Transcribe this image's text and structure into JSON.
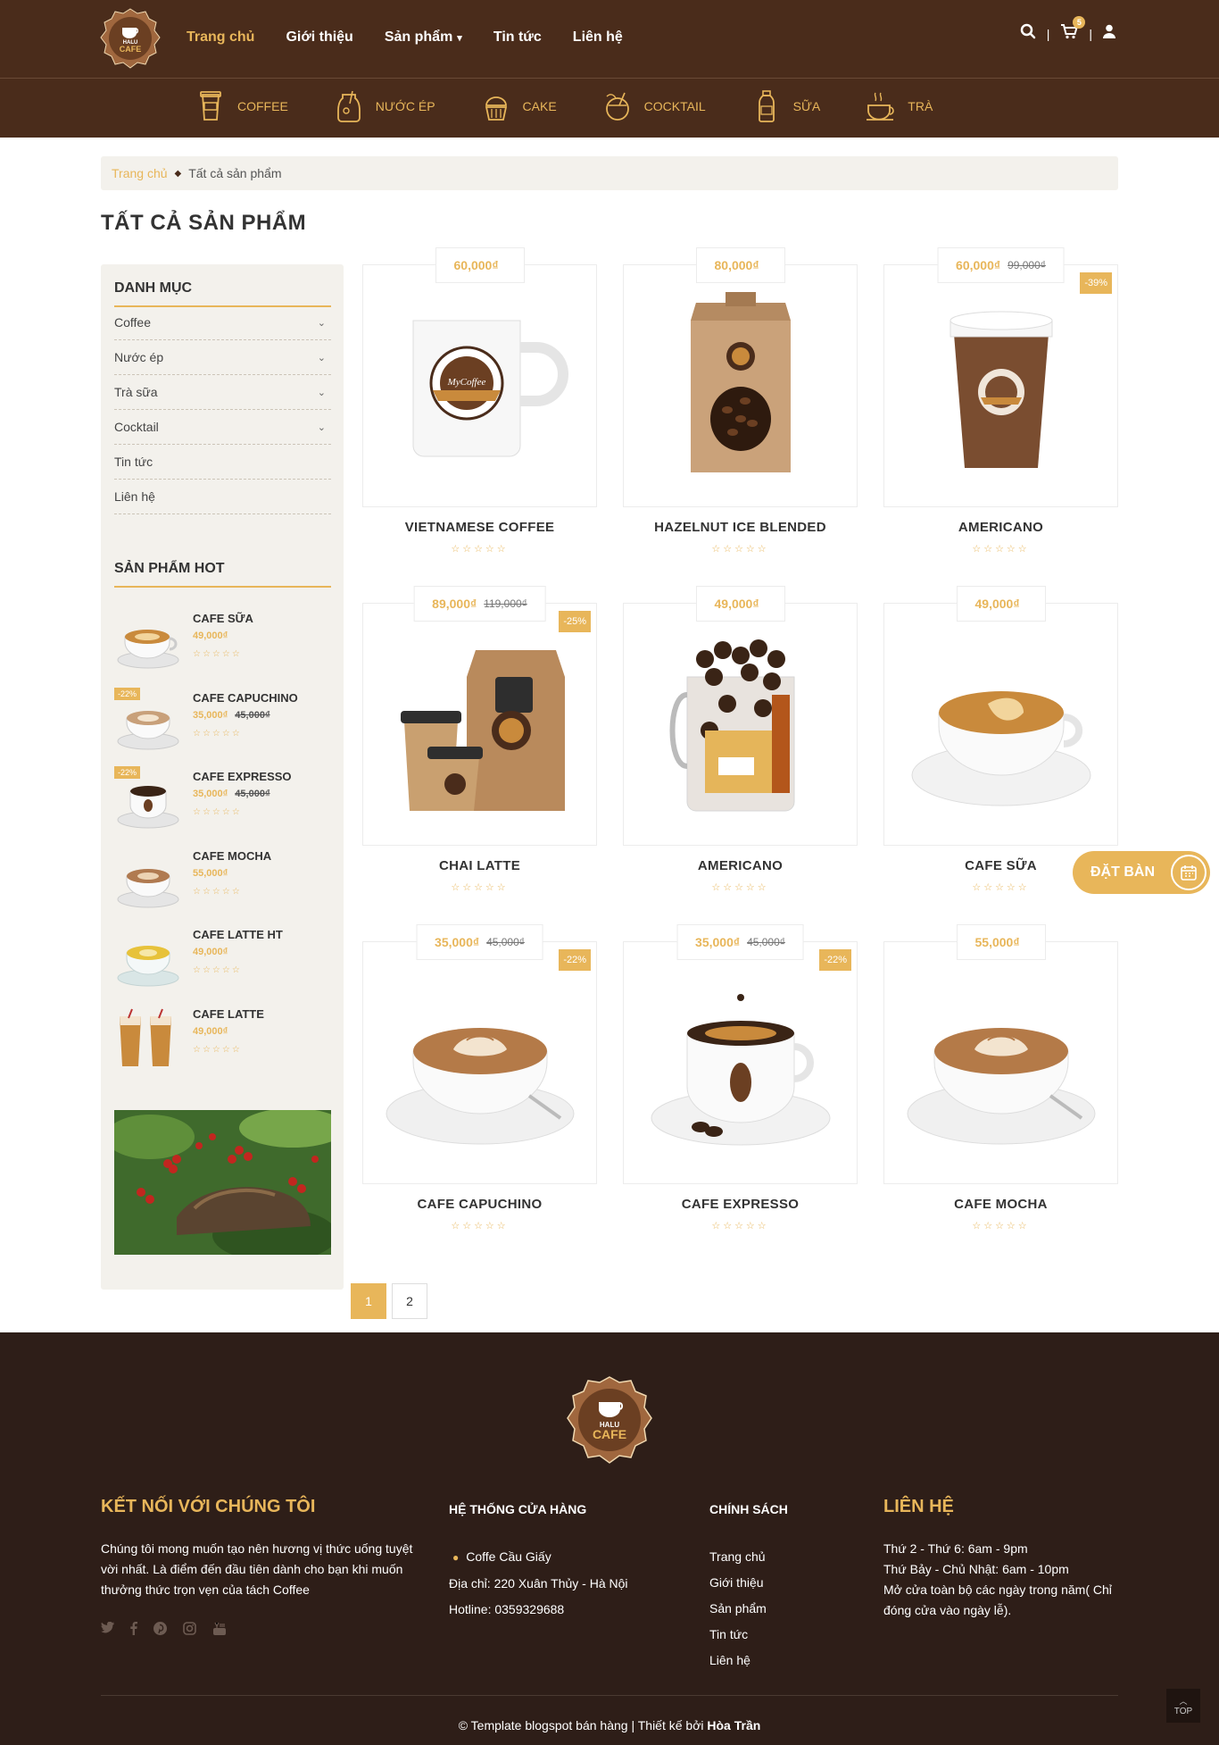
{
  "header": {
    "nav": [
      {
        "label": "Trang chủ",
        "active": true
      },
      {
        "label": "Giới thiệu"
      },
      {
        "label": "Sản phẩm",
        "has_dropdown": true
      },
      {
        "label": "Tin tức"
      },
      {
        "label": "Liên hệ"
      }
    ],
    "cart_count": "5",
    "separator": "|",
    "logo_text_top": "HALU",
    "logo_text_main": "CAFE"
  },
  "categories": [
    {
      "label": "COFFEE",
      "icon": "coffee-cup-icon"
    },
    {
      "label": "NƯỚC ÉP",
      "icon": "juice-jar-icon"
    },
    {
      "label": "CAKE",
      "icon": "cupcake-icon"
    },
    {
      "label": "COCKTAIL",
      "icon": "coconut-drink-icon"
    },
    {
      "label": "SỮA",
      "icon": "milk-bottle-icon"
    },
    {
      "label": "TRÀ",
      "icon": "tea-cup-icon"
    }
  ],
  "breadcrumb": {
    "home": "Trang chủ",
    "separator": "◆",
    "current": "Tất cả sản phẩm"
  },
  "page_title": "TẤT CẢ SẢN PHẨM",
  "sidebar": {
    "category_heading": "DANH MỤC",
    "category_items": [
      {
        "label": "Coffee",
        "chevron": "⌄"
      },
      {
        "label": "Nước ép",
        "chevron": "⌄"
      },
      {
        "label": "Trà sữa",
        "chevron": "⌄"
      },
      {
        "label": "Cocktail",
        "chevron": "⌄"
      },
      {
        "label": "Tin tức",
        "chevron": ""
      },
      {
        "label": "Liên hệ",
        "chevron": ""
      }
    ],
    "hot_heading": "SẢN PHẨM HOT",
    "hot_items": [
      {
        "name": "CAFE SỮA",
        "price": "49,000₫",
        "old_price": "",
        "badge": "",
        "stars": "☆☆☆☆☆"
      },
      {
        "name": "CAFE CAPUCHINO",
        "price": "35,000₫",
        "old_price": "45,000₫",
        "badge": "-22%",
        "stars": "☆☆☆☆☆"
      },
      {
        "name": "CAFE EXPRESSO",
        "price": "35,000₫",
        "old_price": "45,000₫",
        "badge": "-22%",
        "stars": "☆☆☆☆☆"
      },
      {
        "name": "CAFE MOCHA",
        "price": "55,000₫",
        "old_price": "",
        "badge": "",
        "stars": "☆☆☆☆☆"
      },
      {
        "name": "CAFE LATTE HT",
        "price": "49,000₫",
        "old_price": "",
        "badge": "",
        "stars": "☆☆☆☆☆"
      },
      {
        "name": "CAFE LATTE",
        "price": "49,000₫",
        "old_price": "",
        "badge": "",
        "stars": "☆☆☆☆☆"
      }
    ]
  },
  "products": [
    {
      "name": "VIETNAMESE COFFEE",
      "price": "60,000₫",
      "old_price": "",
      "discount": "",
      "stars": "☆☆☆☆☆",
      "image": "mug"
    },
    {
      "name": "HAZELNUT ICE BLENDED",
      "price": "80,000₫",
      "old_price": "",
      "discount": "",
      "stars": "☆☆☆☆☆",
      "image": "bag"
    },
    {
      "name": "AMERICANO",
      "price": "60,000₫",
      "old_price": "99,000₫",
      "discount": "-39%",
      "stars": "☆☆☆☆☆",
      "image": "papercup"
    },
    {
      "name": "CHAI LATTE",
      "price": "89,000₫",
      "old_price": "119,000₫",
      "discount": "-25%",
      "stars": "☆☆☆☆☆",
      "image": "takeaway"
    },
    {
      "name": "AMERICANO",
      "price": "49,000₫",
      "old_price": "",
      "discount": "",
      "stars": "☆☆☆☆☆",
      "image": "glass"
    },
    {
      "name": "CAFE SỮA",
      "price": "49,000₫",
      "old_price": "",
      "discount": "",
      "stars": "☆☆☆☆☆",
      "image": "latte"
    },
    {
      "name": "CAFE CAPUCHINO",
      "price": "35,000₫",
      "old_price": "45,000₫",
      "discount": "-22%",
      "stars": "☆☆☆☆☆",
      "image": "cappuccino"
    },
    {
      "name": "CAFE EXPRESSO",
      "price": "35,000₫",
      "old_price": "45,000₫",
      "discount": "-22%",
      "stars": "☆☆☆☆☆",
      "image": "espresso"
    },
    {
      "name": "CAFE MOCHA",
      "price": "55,000₫",
      "old_price": "",
      "discount": "",
      "stars": "☆☆☆☆☆",
      "image": "cappuccino"
    }
  ],
  "pagination": [
    {
      "label": "1",
      "active": true
    },
    {
      "label": "2",
      "active": false
    }
  ],
  "booking": {
    "label": "ĐẶT BÀN",
    "icon": "calendar-icon"
  },
  "footer": {
    "connect_heading": "KẾT NỐI VỚI CHÚNG TÔI",
    "connect_text": "Chúng tôi mong muốn tạo nên hương vị thức uống tuyệt vời nhất. Là điểm đến đầu tiên dành cho bạn khi muốn thưởng thức trọn vẹn của tách Coffee",
    "social": [
      "twitter-icon",
      "facebook-icon",
      "pinterest-icon",
      "instagram-icon",
      "youtube-icon"
    ],
    "store_heading": "HỆ THỐNG CỬA HÀNG",
    "store_name": "Coffe Cầu Giấy",
    "store_address": "Địa chỉ: 220 Xuân Thủy - Hà Nội",
    "store_hotline": "Hotline: 0359329688",
    "policy_heading": "CHÍNH SÁCH",
    "policy_links": [
      "Trang chủ",
      "Giới thiệu",
      "Sản phẩm",
      "Tin tức",
      "Liên hệ"
    ],
    "contact_heading": "LIÊN HỆ",
    "contact_lines": [
      "Thứ 2 - Thứ 6: 6am - 9pm",
      "Thứ Bảy - Chủ Nhật: 6am - 10pm",
      "Mở cửa toàn bộ các ngày trong năm( Chỉ đóng cửa vào ngày lễ)."
    ],
    "copyright": "© Template blogspot bán hàng | Thiết kế bởi ",
    "author": "Hòa Trần",
    "to_top": "TOP"
  },
  "colors": {
    "brand_dark": "#4a2c1b",
    "accent": "#e8b65a",
    "footer_bg": "#2e1e18",
    "sidebar_bg": "#f3f1ec"
  }
}
